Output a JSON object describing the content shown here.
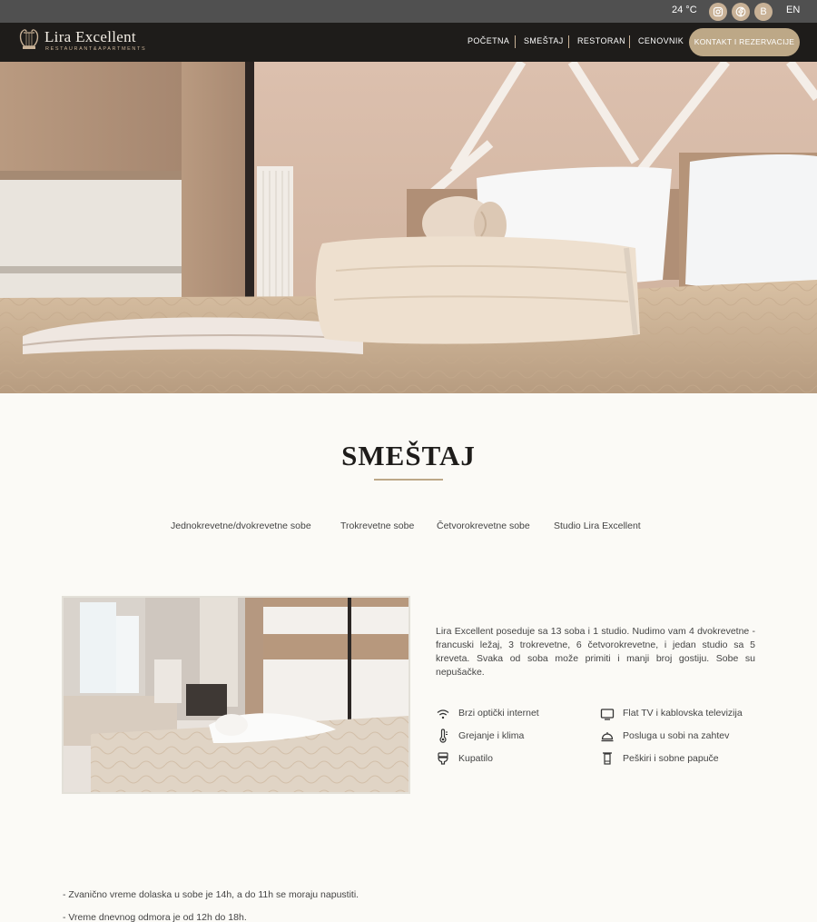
{
  "topbar": {
    "temperature": "24 °C",
    "social": [
      {
        "name": "instagram-icon"
      },
      {
        "name": "facebook-icon"
      },
      {
        "name": "booking-icon",
        "glyph": "B"
      }
    ],
    "language": "EN"
  },
  "logo": {
    "title": "Lira Excellent",
    "subtitle": "RESTAURANT&APARTMENTS"
  },
  "nav": {
    "items": [
      "POČETNA",
      "SMEŠTAJ",
      "RESTORAN",
      "CENOVNIK"
    ],
    "cta": "KONTAKT I REZERVACIJE"
  },
  "section": {
    "title": "SMEŠTAJ"
  },
  "tabs": [
    "Jednokrevetne/dvokrevetne sobe",
    "Trokrevetne sobe",
    "Četvorokrevetne sobe",
    "Studio Lira Excellent"
  ],
  "intro": "Lira Excellent poseduje sa 13 soba i 1 studio. Nudimo vam 4 dvokrevetne - francuski ležaj, 3 trokrevetne, 6 četvorokrevetne, i jedan studio sa 5 kreveta. Svaka od soba može primiti i manji broj gostiju. Sobe su nepušačke.",
  "amenities": [
    {
      "icon": "wifi-icon",
      "label": "Brzi optički internet"
    },
    {
      "icon": "tv-icon",
      "label": "Flat TV i kablovska televizija"
    },
    {
      "icon": "thermometer-icon",
      "label": "Grejanje i klima"
    },
    {
      "icon": "service-bell-icon",
      "label": "Posluga u sobi na zahtev"
    },
    {
      "icon": "toilet-icon",
      "label": "Kupatilo"
    },
    {
      "icon": "towel-icon",
      "label": "Peškiri i sobne papuče"
    }
  ],
  "notes": [
    "- Zvanično vreme dolaska u sobe je 14h, a do 11h se moraju napustiti.",
    "- Vreme dnevnog odmora je od 12h do 18h."
  ],
  "colors": {
    "accent": "#bda887",
    "navbar": "#1e1c1a",
    "topbar": "#505050",
    "background": "#fbfaf6"
  }
}
